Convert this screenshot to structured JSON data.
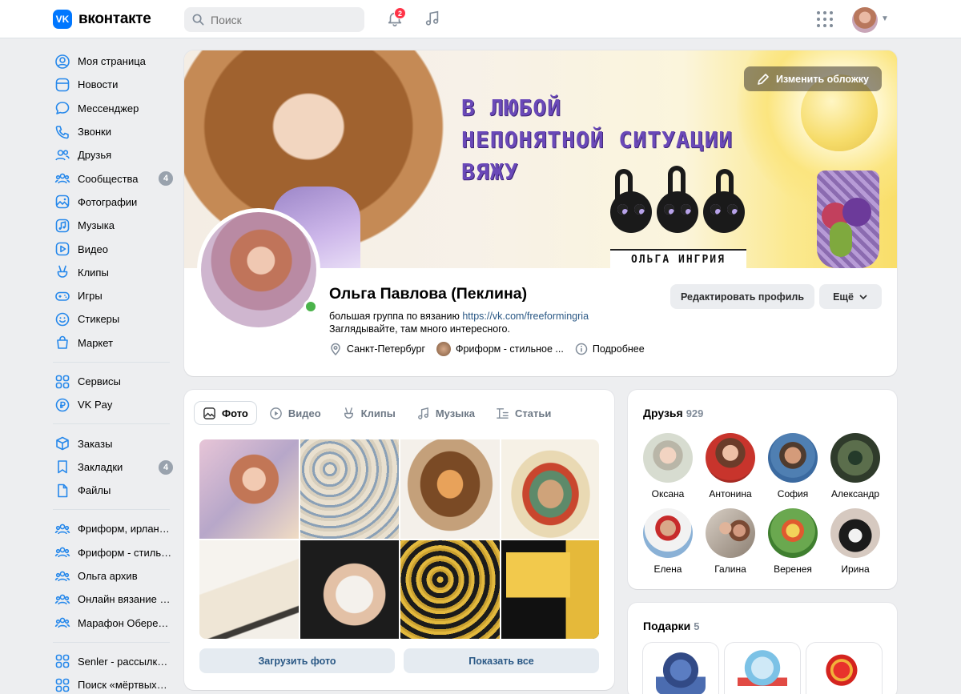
{
  "header": {
    "logo_text": "вконтакте",
    "logo_mark": "VK",
    "search_placeholder": "Поиск",
    "notifications_count": "2"
  },
  "sidebar": {
    "groups": [
      [
        {
          "label": "Моя страница",
          "icon": "user-circle-icon"
        },
        {
          "label": "Новости",
          "icon": "newsfeed-icon"
        },
        {
          "label": "Мессенджер",
          "icon": "message-icon"
        },
        {
          "label": "Звонки",
          "icon": "phone-icon"
        },
        {
          "label": "Друзья",
          "icon": "friends-icon"
        },
        {
          "label": "Сообщества",
          "icon": "communities-icon",
          "count": "4"
        },
        {
          "label": "Фотографии",
          "icon": "photo-icon"
        },
        {
          "label": "Музыка",
          "icon": "music-icon"
        },
        {
          "label": "Видео",
          "icon": "video-icon"
        },
        {
          "label": "Клипы",
          "icon": "clips-icon"
        },
        {
          "label": "Игры",
          "icon": "gamepad-icon"
        },
        {
          "label": "Стикеры",
          "icon": "smile-icon"
        },
        {
          "label": "Маркет",
          "icon": "market-bag-icon"
        }
      ],
      [
        {
          "label": "Сервисы",
          "icon": "services-icon"
        },
        {
          "label": "VK Pay",
          "icon": "vkpay-icon"
        }
      ],
      [
        {
          "label": "Заказы",
          "icon": "box-icon"
        },
        {
          "label": "Закладки",
          "icon": "bookmark-icon",
          "count": "4"
        },
        {
          "label": "Файлы",
          "icon": "file-icon"
        }
      ],
      [
        {
          "label": "Фриформ, ирланд...",
          "icon": "communities-icon"
        },
        {
          "label": "Фриформ - стильн...",
          "icon": "communities-icon"
        },
        {
          "label": "Ольга архив",
          "icon": "communities-icon"
        },
        {
          "label": "Онлайн вязание к...",
          "icon": "communities-icon"
        },
        {
          "label": "Марафон Обереж...",
          "icon": "communities-icon"
        }
      ],
      [
        {
          "label": "Senler - рассылки ...",
          "icon": "services-icon"
        },
        {
          "label": "Поиск «мёртвых» ...",
          "icon": "services-icon"
        }
      ]
    ]
  },
  "profile": {
    "cover_button": "Изменить обложку",
    "cover_text": [
      "В ЛЮБОЙ",
      "НЕПОНЯТНОЙ СИТУАЦИИ",
      "ВЯЖУ"
    ],
    "cover_signature": "ОЛЬГА ИНГРИЯ",
    "name": "Ольга Павлова (Пеклина)",
    "status_prefix": "большая группа по вязанию ",
    "status_link": "https://vk.com/freeformingria",
    "status_line2": "Заглядывайте, там много интересного.",
    "city": "Санкт-Петербург",
    "group": "Фриформ - стильное ...",
    "details": "Подробнее",
    "edit_button": "Редактировать профиль",
    "more_button": "Ещё"
  },
  "media": {
    "tabs": [
      {
        "label": "Фото",
        "icon": "photo-icon",
        "active": true
      },
      {
        "label": "Видео",
        "icon": "play-circle-icon"
      },
      {
        "label": "Клипы",
        "icon": "clips-icon"
      },
      {
        "label": "Музыка",
        "icon": "music-icon"
      },
      {
        "label": "Статьи",
        "icon": "article-icon"
      }
    ],
    "upload_button": "Загрузить фото",
    "show_all_button": "Показать все"
  },
  "friends": {
    "title": "Друзья",
    "count": "929",
    "items": [
      "Оксана",
      "Антонина",
      "София",
      "Александр",
      "Елена",
      "Галина",
      "Веренея",
      "Ирина"
    ]
  },
  "gifts": {
    "title": "Подарки",
    "count": "5"
  },
  "colors": {
    "accent": "#0077ff",
    "link": "#2a5885",
    "online": "#4bb34b",
    "badge": "#ff3347"
  }
}
